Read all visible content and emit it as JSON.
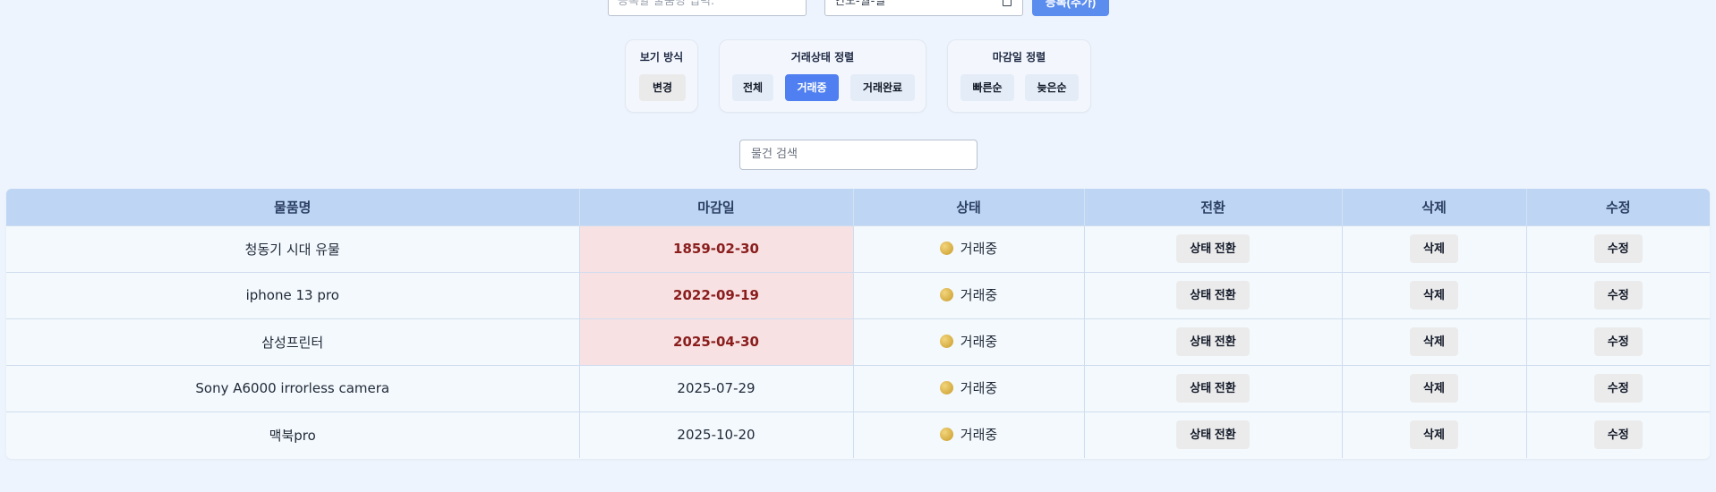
{
  "register": {
    "name_placeholder": "등록할 물품명 입력.",
    "date_value": "연도-월-일",
    "add_label": "등록(추가)"
  },
  "view_panel": {
    "title": "보기 방식",
    "change_label": "변경"
  },
  "status_panel": {
    "title": "거래상태 정렬",
    "options": [
      "전체",
      "거래중",
      "거래완료"
    ],
    "active": "거래중"
  },
  "deadline_panel": {
    "title": "마감일 정렬",
    "options": [
      "빠른순",
      "늦은순"
    ]
  },
  "search": {
    "placeholder": "물건 검색"
  },
  "table": {
    "headers": [
      "물품명",
      "마감일",
      "상태",
      "전환",
      "삭제",
      "수정"
    ],
    "toggle_label": "상태 전환",
    "delete_label": "삭제",
    "edit_label": "수정",
    "rows": [
      {
        "name": "청동기 시대 유물",
        "deadline": "1859-02-30",
        "status": "거래중",
        "overdue": true
      },
      {
        "name": "iphone 13 pro",
        "deadline": "2022-09-19",
        "status": "거래중",
        "overdue": true
      },
      {
        "name": "삼성프린터",
        "deadline": "2025-04-30",
        "status": "거래중",
        "overdue": true
      },
      {
        "name": "Sony A6000 irrorless camera",
        "deadline": "2025-07-29",
        "status": "거래중",
        "overdue": false
      },
      {
        "name": "맥북pro",
        "deadline": "2025-10-20",
        "status": "거래중",
        "overdue": false
      }
    ]
  },
  "colors": {
    "accent": "#4f7ff0",
    "header_bg": "#bed6f4",
    "overdue_bg": "#f7e1e2",
    "overdue_text": "#8b1d1d",
    "status_dot": "#d8ae45"
  }
}
